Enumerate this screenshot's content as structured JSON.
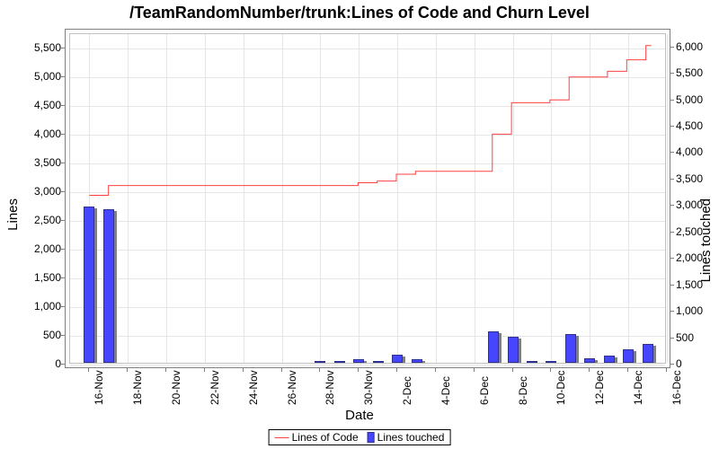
{
  "title": "/TeamRandomNumber/trunk:Lines of Code and Churn Level",
  "xlabel": "Date",
  "ylabel_left": "Lines",
  "ylabel_right": "Lines touched",
  "legend": {
    "loc": "Lines of Code",
    "churn": "Lines touched"
  },
  "axes": {
    "x_categories": [
      "16-Nov",
      "18-Nov",
      "20-Nov",
      "22-Nov",
      "24-Nov",
      "26-Nov",
      "28-Nov",
      "30-Nov",
      "2-Dec",
      "4-Dec",
      "6-Dec",
      "8-Dec",
      "10-Dec",
      "12-Dec",
      "14-Dec",
      "16-Dec"
    ],
    "y_left_ticks": [
      0,
      500,
      1000,
      1500,
      2000,
      2500,
      3000,
      3500,
      4000,
      4500,
      5000,
      5500
    ],
    "y_right_ticks": [
      0,
      500,
      1000,
      1500,
      2000,
      2500,
      3000,
      3500,
      4000,
      4500,
      5000,
      5500,
      6000
    ],
    "y_left_max": 5750,
    "y_right_max": 6250
  },
  "chart_data": {
    "type": "bar",
    "title": "/TeamRandomNumber/trunk:Lines of Code and Churn Level",
    "xlabel": "Date",
    "ylabel_left": "Lines",
    "ylabel_right": "Lines touched",
    "x_domain": [
      "15-Nov",
      "16-Dec"
    ],
    "y_left_range": [
      0,
      5750
    ],
    "y_right_range": [
      0,
      6250
    ],
    "series": [
      {
        "name": "Lines touched",
        "axis": "right",
        "kind": "bar",
        "points": [
          {
            "x": "16-Nov",
            "y": 2950
          },
          {
            "x": "17-Nov",
            "y": 2900
          },
          {
            "x": "28-Nov",
            "y": 20
          },
          {
            "x": "29-Nov",
            "y": 20
          },
          {
            "x": "30-Nov",
            "y": 70
          },
          {
            "x": "1-Dec",
            "y": 30
          },
          {
            "x": "2-Dec",
            "y": 160
          },
          {
            "x": "3-Dec",
            "y": 70
          },
          {
            "x": "7-Dec",
            "y": 590
          },
          {
            "x": "8-Dec",
            "y": 500
          },
          {
            "x": "9-Dec",
            "y": 20
          },
          {
            "x": "10-Dec",
            "y": 20
          },
          {
            "x": "11-Dec",
            "y": 550
          },
          {
            "x": "12-Dec",
            "y": 80
          },
          {
            "x": "13-Dec",
            "y": 130
          },
          {
            "x": "14-Dec",
            "y": 250
          },
          {
            "x": "15-Dec",
            "y": 360
          }
        ]
      },
      {
        "name": "Lines of Code",
        "axis": "left",
        "kind": "line",
        "points": [
          {
            "x": "16-Nov",
            "y": 2930
          },
          {
            "x": "17-Nov",
            "y": 3100
          },
          {
            "x": "28-Nov",
            "y": 3100
          },
          {
            "x": "29-Nov",
            "y": 3100
          },
          {
            "x": "30-Nov",
            "y": 3150
          },
          {
            "x": "1-Dec",
            "y": 3180
          },
          {
            "x": "2-Dec",
            "y": 3300
          },
          {
            "x": "3-Dec",
            "y": 3350
          },
          {
            "x": "5-Dec",
            "y": 3350
          },
          {
            "x": "6-Dec",
            "y": 3350
          },
          {
            "x": "7-Dec",
            "y": 4000
          },
          {
            "x": "8-Dec",
            "y": 4550
          },
          {
            "x": "10-Dec",
            "y": 4600
          },
          {
            "x": "11-Dec",
            "y": 5000
          },
          {
            "x": "12-Dec",
            "y": 5000
          },
          {
            "x": "13-Dec",
            "y": 5100
          },
          {
            "x": "14-Dec",
            "y": 5300
          },
          {
            "x": "15-Dec",
            "y": 5550
          }
        ]
      }
    ]
  }
}
